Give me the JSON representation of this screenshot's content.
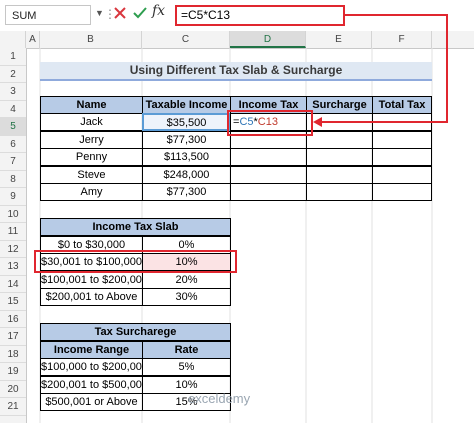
{
  "formula_bar": {
    "name_box": "SUM",
    "fx_label": "fx",
    "formula": "=C5*C13"
  },
  "columns": [
    "A",
    "B",
    "C",
    "D",
    "E",
    "F"
  ],
  "active_column": "D",
  "rows": [
    "1",
    "2",
    "3",
    "4",
    "5",
    "6",
    "7",
    "8",
    "9",
    "10",
    "11",
    "12",
    "13",
    "14",
    "15",
    "16",
    "17",
    "18",
    "19",
    "20",
    "21"
  ],
  "active_row": "5",
  "title": "Using Different Tax Slab & Surcharge",
  "main_table": {
    "headers": [
      "Name",
      "Taxable Income",
      "Income Tax",
      "Surcharge",
      "Total Tax"
    ],
    "rows": [
      {
        "name": "Jack",
        "income": "$35,500"
      },
      {
        "name": "Jerry",
        "income": "$77,300"
      },
      {
        "name": "Penny",
        "income": "$113,500"
      },
      {
        "name": "Steve",
        "income": "$248,000"
      },
      {
        "name": "Amy",
        "income": "$77,300"
      }
    ],
    "editing_cell": {
      "eq": "=",
      "ref1": "C5",
      "op": "*",
      "ref2": "C13"
    }
  },
  "slab_table": {
    "header": "Income Tax Slab",
    "rows": [
      {
        "range": "$0 to $30,000",
        "rate": "0%"
      },
      {
        "range": "$30,001 to $100,000",
        "rate": "10%"
      },
      {
        "range": "$100,001 to $200,000",
        "rate": "20%"
      },
      {
        "range": "$200,001 to Above",
        "rate": "30%"
      }
    ]
  },
  "surcharge_table": {
    "header": "Tax Surcharege",
    "col_headers": [
      "Income Range",
      "Rate"
    ],
    "rows": [
      {
        "range": "$100,000 to $200,000",
        "rate": "5%"
      },
      {
        "range": "$200,001 to $500,000",
        "rate": "10%"
      },
      {
        "range": "$500,001 or Above",
        "rate": "15%"
      }
    ]
  },
  "watermark": "exceldemy",
  "colors": {
    "accent": "#217346",
    "highlight": "#e0262f",
    "header_fill": "#b7cbe6"
  }
}
